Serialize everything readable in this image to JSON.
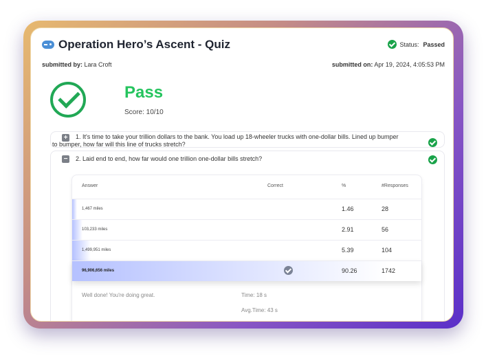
{
  "quiz": {
    "title": "Operation Hero’s Ascent - Quiz",
    "status_label": "Status:",
    "status_value": "Passed",
    "submitted_by_label": "submitted by:",
    "submitted_by_value": "Lara Croft",
    "submitted_on_label": "submitted on:",
    "submitted_on_value": "Apr 19, 2024, 4:05:53 PM",
    "result": "Pass",
    "score": "Score: 10/10"
  },
  "questions": [
    {
      "line1": "1. It's time to take your trillion dollars to the bank. You load up 18-wheeler trucks with one-dollar bills. Lined up bumper",
      "line2": "to bumper, how far will this line of trucks stretch?"
    },
    {
      "text": "2. Laid end to end, how far would one trillion one-dollar bills stretch?"
    }
  ],
  "table": {
    "headers": {
      "answer": "Answer",
      "correct": "Correct",
      "pct": "%",
      "responses": "#Responses"
    },
    "rows": [
      {
        "answer": "1,467 miles",
        "pct": "1.46",
        "responses": "28",
        "share": 1.46
      },
      {
        "answer": "103,233 miles",
        "pct": "2.91",
        "responses": "56",
        "share": 2.91
      },
      {
        "answer": "1,499,951 miles",
        "pct": "5.39",
        "responses": "104",
        "share": 5.39
      },
      {
        "answer": "96,906,656 miles",
        "pct": "90.26",
        "responses": "1742",
        "share": 90.26
      }
    ],
    "feedback": "Well done! You're doing great.",
    "time": "Time: 18 s",
    "avg_time": "Avg.Time: 43 s"
  },
  "colors": {
    "pass_green": "#25c45e",
    "check_green": "#1aa34a",
    "bar_start": "#b5c1ff"
  },
  "icons": [
    "gamepad-icon",
    "check-circle-icon",
    "plus-icon",
    "minus-icon"
  ]
}
